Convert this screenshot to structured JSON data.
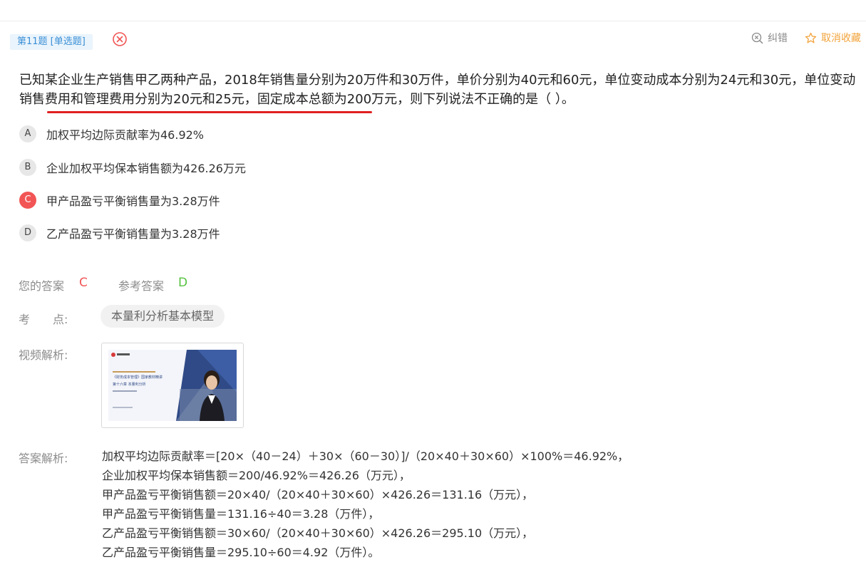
{
  "question": {
    "tag": "第11题 [单选题]",
    "text_before": "已知某企业生产销售甲乙两种产品，2018年销售量分别为20万件和30万件，单价分别为40元和60元，单位变动成本分别为24元和30元，",
    "text_highlight": "单位变动销售费用和管理费用分别为20元和25元，",
    "text_after": "固定成本总额为200万元，则下列说法不正确的是（ ）。"
  },
  "toolbar": {
    "report_label": "纠错",
    "unfavorite_label": "取消收藏"
  },
  "options": [
    {
      "letter": "A",
      "text": "加权平均边际贡献率为46.92%"
    },
    {
      "letter": "B",
      "text": "企业加权平均保本销售额为426.26万元"
    },
    {
      "letter": "C",
      "text": "甲产品盈亏平衡销售量为3.28万件"
    },
    {
      "letter": "D",
      "text": "乙产品盈亏平衡销售量为3.28万件"
    }
  ],
  "answers": {
    "your_label": "您的答案",
    "your_value": "C",
    "ref_label": "参考答案",
    "ref_value": "D"
  },
  "knowledge": {
    "label": "考　　点:",
    "tag": "本量利分析基本模型"
  },
  "video": {
    "label": "视频解析:",
    "slide_lines": [
      "《财务成本管理》国家教材精讲",
      "第十六章 本量利分析"
    ]
  },
  "analysis": {
    "label": "答案解析:",
    "lines": [
      "加权平均边际贡献率＝[20×（40－24）＋30×（60－30）]/（20×40＋30×60）×100%＝46.92%，",
      "企业加权平均保本销售额＝200/46.92%＝426.26（万元），",
      "甲产品盈亏平衡销售额＝20×40/（20×40＋30×60）×426.26＝131.16（万元），",
      "甲产品盈亏平衡销售量＝131.16÷40＝3.28（万件），",
      "乙产品盈亏平衡销售额＝30×60/（20×40＋30×60）×426.26＝295.10（万元），",
      "乙产品盈亏平衡销售量＝295.10÷60＝4.92（万件）。"
    ]
  },
  "colors": {
    "wrong": "#f25555",
    "correct": "#55c240",
    "tag_blue": "#3a8fd6",
    "star": "#f2a33b",
    "underline": "#e02020"
  },
  "icons": [
    "wrong-mark-icon",
    "report-error-icon",
    "star-icon",
    "play-video-icon"
  ]
}
